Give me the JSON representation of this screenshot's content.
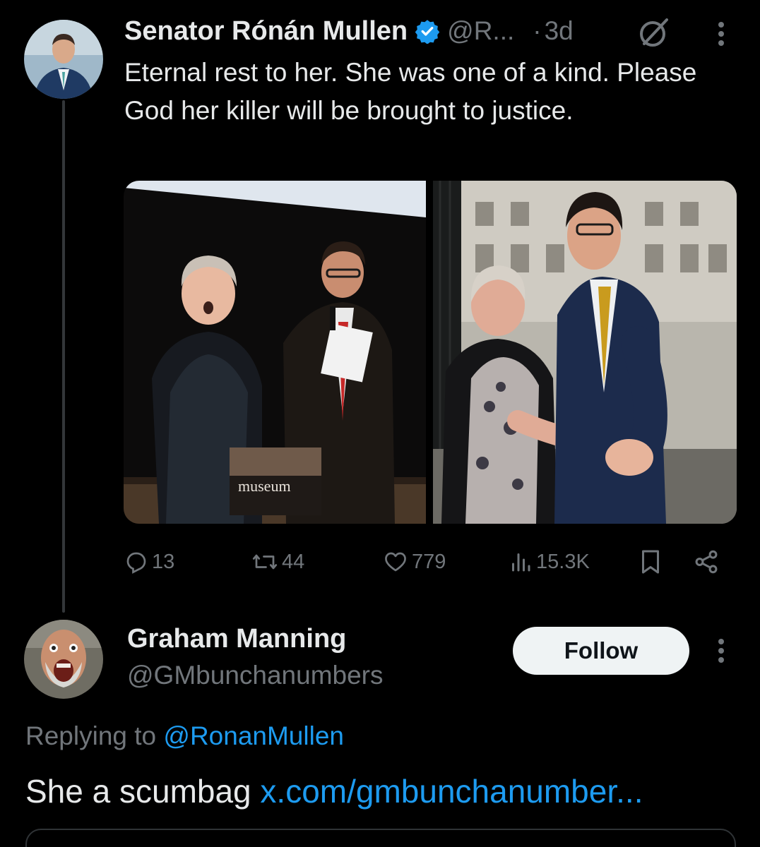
{
  "tweet": {
    "author_name": "Senator Rónán Mullen",
    "author_handle": "@R...",
    "separator": "·",
    "time": "3d",
    "text": "Eternal rest to her. She was one of a kind. Please God her killer will be brought to justice.",
    "media": [
      {
        "description_icon": "photo-stage-event",
        "caption": "museum"
      },
      {
        "description_icon": "photo-outdoor-dance"
      }
    ],
    "stats": {
      "replies": "13",
      "reposts": "44",
      "likes": "779",
      "views": "15.3K"
    }
  },
  "reply": {
    "author_name": "Graham Manning",
    "author_handle": "@GMbunchanumbers",
    "follow_label": "Follow",
    "replying_prefix": "Replying to ",
    "replying_mention": "@RonanMullen",
    "text": "She a scumbag ",
    "link": "x.com/gmbunchanumber..."
  },
  "colors": {
    "background": "#000000",
    "text_primary": "#e7e9ea",
    "text_secondary": "#71767b",
    "accent": "#1d9bf0",
    "verified": "#1d9bf0"
  }
}
